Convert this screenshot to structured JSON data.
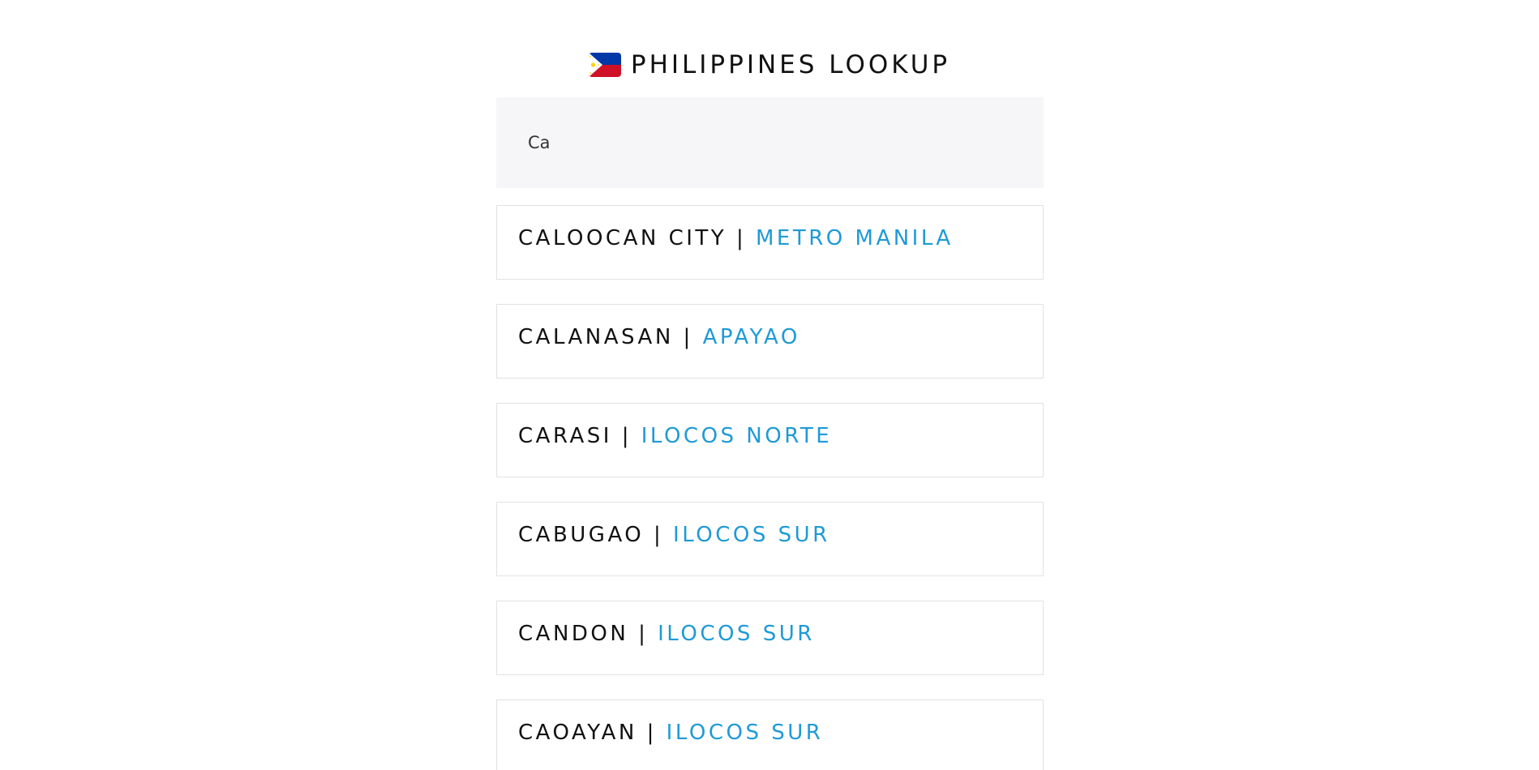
{
  "header": {
    "title": "PHILIPPINES LOOKUP",
    "flag_icon": "philippines-flag-icon"
  },
  "search": {
    "value": "Ca",
    "placeholder": ""
  },
  "results": [
    {
      "city": "CALOOCAN CITY",
      "separator": "|",
      "province": "METRO MANILA"
    },
    {
      "city": "CALANASAN",
      "separator": "|",
      "province": "APAYAO"
    },
    {
      "city": "CARASI",
      "separator": "|",
      "province": "ILOCOS NORTE"
    },
    {
      "city": "CABUGAO",
      "separator": "|",
      "province": "ILOCOS SUR"
    },
    {
      "city": "CANDON",
      "separator": "|",
      "province": "ILOCOS SUR"
    },
    {
      "city": "CAOAYAN",
      "separator": "|",
      "province": "ILOCOS SUR"
    }
  ],
  "colors": {
    "province_accent": "#1e9ad6",
    "search_bg": "#f6f6f8",
    "flag_blue": "#0038a8",
    "flag_red": "#ce1126",
    "flag_yellow": "#fcd116"
  }
}
